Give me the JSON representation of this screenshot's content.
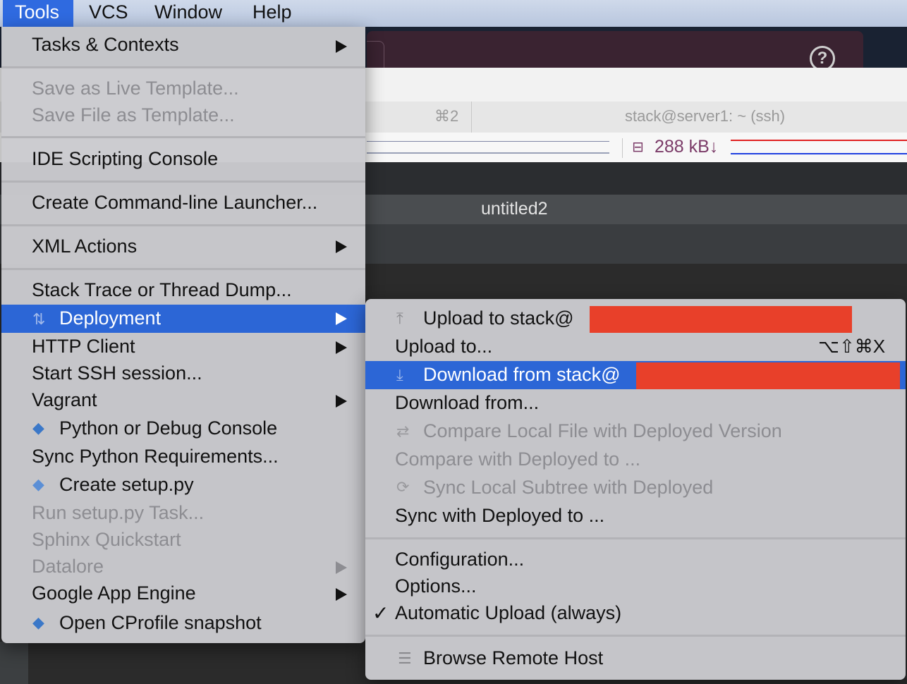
{
  "menubar": {
    "items": [
      "Tools",
      "VCS",
      "Window",
      "Help"
    ]
  },
  "background": {
    "help_glyph": "?",
    "terminal_tab_shortcut": "⌘2",
    "terminal_title": "stack@server1: ~ (ssh)",
    "net_rate": "288 kB↓",
    "editor_title": "untitled2",
    "colors": {
      "net_down": "#e02020",
      "net_up": "#2040e0",
      "net_text": "#7b3b68"
    }
  },
  "tools_menu": {
    "tasks_contexts": "Tasks & Contexts",
    "save_live_template": "Save as Live Template...",
    "save_file_template": "Save File as Template...",
    "ide_scripting_console": "IDE Scripting Console",
    "create_cli_launcher": "Create Command-line Launcher...",
    "xml_actions": "XML Actions",
    "stack_trace": "Stack Trace or Thread Dump...",
    "deployment": "Deployment",
    "http_client": "HTTP Client",
    "start_ssh": "Start SSH session...",
    "vagrant": "Vagrant",
    "python_debug_console": "Python or Debug Console",
    "sync_python_requirements": "Sync Python Requirements...",
    "create_setup_py": "Create setup.py",
    "run_setup_task": "Run setup.py Task...",
    "sphinx_quickstart": "Sphinx Quickstart",
    "datalore": "Datalore",
    "google_app_engine": "Google App Engine",
    "open_cprofile": "Open CProfile snapshot"
  },
  "deployment_menu": {
    "upload_to_server": "Upload to stack@",
    "upload_to": "Upload to...",
    "upload_to_shortcut": "⌥⇧⌘X",
    "download_from_server": "Download from stack@",
    "download_from": "Download from...",
    "compare_local": "Compare Local File with Deployed Version",
    "compare_with": "Compare with Deployed to ...",
    "sync_subtree": "Sync Local Subtree with Deployed",
    "sync_with": "Sync with Deployed to ...",
    "configuration": "Configuration...",
    "options": "Options...",
    "automatic_upload": "Automatic Upload (always)",
    "checkmark": "✓",
    "browse_remote": "Browse Remote Host"
  }
}
